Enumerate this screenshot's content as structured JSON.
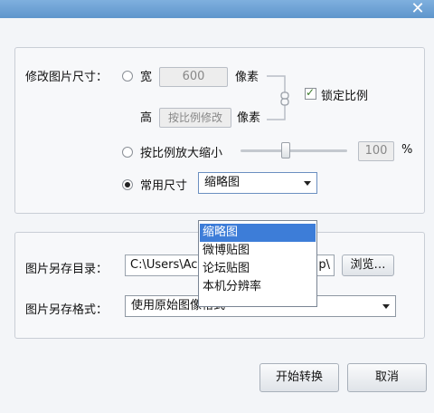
{
  "window": {
    "close_glyph": "✕"
  },
  "resize": {
    "label": "修改图片尺寸：",
    "width_label": "宽",
    "width_value": "600",
    "px_label_1": "像素",
    "height_label": "高",
    "height_value": "按比例修改",
    "px_label_2": "像素",
    "lock_ratio_label": "锁定比例",
    "lock_ratio_checked": true,
    "scale_label": "按比例放大缩小",
    "scale_value": "100",
    "scale_unit": "%",
    "scale_slider_fraction": 0.42,
    "common_size_label": "常用尺寸",
    "common_size_selected": "缩略图",
    "selected_mode": "common_size",
    "dropdown_options": [
      "缩略图",
      "微博贴图",
      "论坛贴图",
      "本机分辨率"
    ]
  },
  "save": {
    "dir_label": "图片另存目录：",
    "dir_value": "C:\\Users\\Ac",
    "dir_value_tail": "p\\",
    "browse_label": "浏览…",
    "format_label": "图片另存格式：",
    "format_value": "使用原始图像格式"
  },
  "footer": {
    "start_label": "开始转换",
    "cancel_label": "取消"
  },
  "colors": {
    "title_bar": "#6fa3d6",
    "selection": "#3d7dd8"
  }
}
